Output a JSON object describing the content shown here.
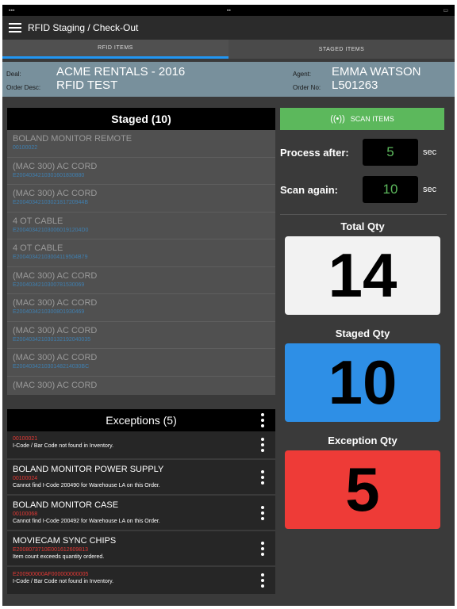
{
  "header": {
    "title": "RFID Staging / Check-Out"
  },
  "tabs": [
    {
      "label": "RFID ITEMS"
    },
    {
      "label": "STAGED ITEMS"
    }
  ],
  "info": {
    "deal_label": "Deal:",
    "deal_value": "ACME RENTALS - 2016",
    "order_desc_label": "Order Desc:",
    "order_desc_value": "RFID TEST",
    "agent_label": "Agent:",
    "agent_value": "EMMA WATSON",
    "order_no_label": "Order No:",
    "order_no_value": "L501263"
  },
  "staged": {
    "title": "Staged (10)",
    "items": [
      {
        "name": "BOLAND MONITOR REMOTE",
        "code": "00100022"
      },
      {
        "name": "(MAC 300) AC CORD",
        "code": "E2004034210301601830880"
      },
      {
        "name": "(MAC 300) AC CORD",
        "code": "E2004034210302181720944B"
      },
      {
        "name": "4 OT CABLE",
        "code": "E200403421030060191204D0"
      },
      {
        "name": "4 OT CABLE",
        "code": "E20040342103004119504B79"
      },
      {
        "name": "(MAC 300) AC CORD",
        "code": "E2004034210300781530069"
      },
      {
        "name": "(MAC 300) AC CORD",
        "code": "E2004034210300801930469"
      },
      {
        "name": "(MAC 300) AC CORD",
        "code": "E200403421030132192040035"
      },
      {
        "name": "(MAC 300) AC CORD",
        "code": "E200403421030148214030BC"
      },
      {
        "name": "(MAC 300) AC CORD",
        "code": ""
      }
    ]
  },
  "exceptions": {
    "title": "Exceptions (5)",
    "items": [
      {
        "name": "",
        "code": "00100021",
        "msg": "I-Code / Bar Code not found in Inventory."
      },
      {
        "name": "BOLAND MONITOR POWER SUPPLY",
        "code": "00100024",
        "msg": "Cannot find I-Code 200490 for Warehouse LA on this Order."
      },
      {
        "name": "BOLAND MONITOR CASE",
        "code": "00100068",
        "msg": "Cannot find I-Code 200492 for Warehouse LA on this Order."
      },
      {
        "name": "MOVIECAM SYNC CHIPS",
        "code": "E2008073710E001612609813",
        "msg": "Item count exceeds quantity ordered."
      },
      {
        "name": "",
        "code": "E200900000AF000000000005",
        "msg": "I-Code / Bar Code not found in Inventory."
      }
    ]
  },
  "scan": {
    "label": "SCAN ITEMS"
  },
  "process_after": {
    "label": "Process after:",
    "value": "5",
    "unit": "sec"
  },
  "scan_again": {
    "label": "Scan again:",
    "value": "10",
    "unit": "sec"
  },
  "quantities": {
    "total": {
      "label": "Total Qty",
      "value": "14",
      "color": "#f2f2f2"
    },
    "staged": {
      "label": "Staged Qty",
      "value": "10",
      "color": "#2e8fe6"
    },
    "exception": {
      "label": "Exception Qty",
      "value": "5",
      "color": "#ee3b37"
    }
  }
}
